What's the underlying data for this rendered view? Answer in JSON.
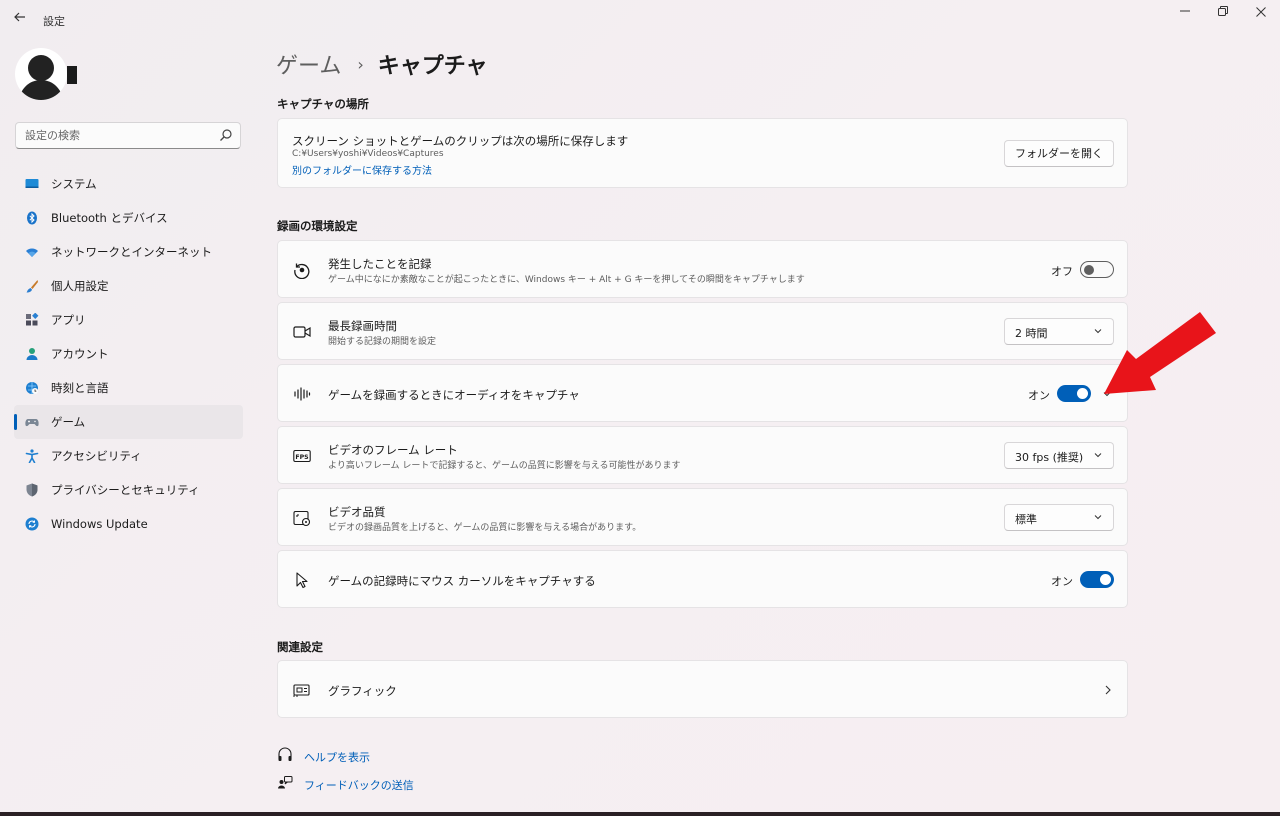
{
  "window": {
    "title": "設定",
    "back_icon": "back-arrow-icon",
    "controls": [
      "minimize-icon",
      "restore-icon",
      "close-icon"
    ]
  },
  "search": {
    "placeholder": "設定の検索"
  },
  "sidebar": {
    "items": [
      {
        "label": "システム",
        "icon": "system-icon"
      },
      {
        "label": "Bluetooth とデバイス",
        "icon": "bluetooth-icon"
      },
      {
        "label": "ネットワークとインターネット",
        "icon": "network-icon"
      },
      {
        "label": "個人用設定",
        "icon": "personalization-brush-icon"
      },
      {
        "label": "アプリ",
        "icon": "apps-icon"
      },
      {
        "label": "アカウント",
        "icon": "account-icon"
      },
      {
        "label": "時刻と言語",
        "icon": "time-language-icon"
      },
      {
        "label": "ゲーム",
        "icon": "gaming-controller-icon",
        "active": true
      },
      {
        "label": "アクセシビリティ",
        "icon": "accessibility-icon"
      },
      {
        "label": "プライバシーとセキュリティ",
        "icon": "privacy-shield-icon"
      },
      {
        "label": "Windows Update",
        "icon": "windows-update-icon"
      }
    ]
  },
  "breadcrumb": {
    "parent": "ゲーム",
    "separator": "›",
    "current": "キャプチャ"
  },
  "capture_location": {
    "section_title": "キャプチャの場所",
    "title": "スクリーン ショットとゲームのクリップは次の場所に保存します",
    "path": "C:¥Users¥yoshi¥Videos¥Captures",
    "link": "別のフォルダーに保存する方法",
    "button": "フォルダーを開く"
  },
  "recording": {
    "section_title": "録画の環境設定",
    "record_what_happened": {
      "title": "発生したことを記録",
      "subtitle": "ゲーム中になにか素敵なことが起こったときに、Windows キー + Alt + G キーを押してその瞬間をキャプチャします",
      "toggle_label": "オフ",
      "toggle_on": false
    },
    "max_length": {
      "title": "最長録画時間",
      "subtitle": "開始する記録の期間を設定",
      "value": "2 時間"
    },
    "capture_audio": {
      "title": "ゲームを録画するときにオーディオをキャプチャ",
      "toggle_label": "オン",
      "toggle_on": true
    },
    "frame_rate": {
      "title": "ビデオのフレーム レート",
      "subtitle": "より高いフレーム レートで記録すると、ゲームの品質に影響を与える可能性があります",
      "value": "30 fps (推奨)"
    },
    "video_quality": {
      "title": "ビデオ品質",
      "subtitle": "ビデオの録画品質を上げると、ゲームの品質に影響を与える場合があります。",
      "value": "標準"
    },
    "capture_cursor": {
      "title": "ゲームの記録時にマウス カーソルをキャプチャする",
      "toggle_label": "オン",
      "toggle_on": true
    }
  },
  "related": {
    "section_title": "関連設定",
    "graphics": "グラフィック"
  },
  "footer": {
    "help": "ヘルプを表示",
    "feedback": "フィードバックの送信"
  },
  "colors": {
    "accent": "#005fb8",
    "annotation_arrow": "#e8141a"
  }
}
